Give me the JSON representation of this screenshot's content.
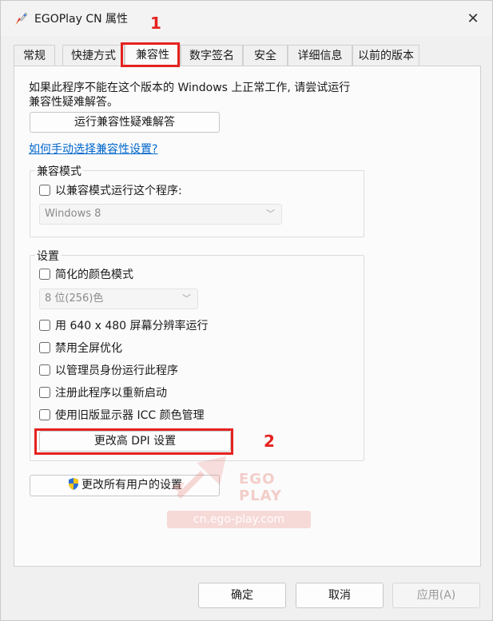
{
  "window": {
    "title": "EGOPlay CN 属性"
  },
  "tabs": [
    {
      "label": "常规"
    },
    {
      "label": "快捷方式"
    },
    {
      "label": "兼容性"
    },
    {
      "label": "数字签名"
    },
    {
      "label": "安全"
    },
    {
      "label": "详细信息"
    },
    {
      "label": "以前的版本"
    }
  ],
  "intro": {
    "line1": "如果此程序不能在这个版本的 Windows 上正常工作, 请尝试运行",
    "line2": "兼容性疑难解答。"
  },
  "troubleshoot_button": "运行兼容性疑难解答",
  "manual_link": "如何手动选择兼容性设置?",
  "compat_mode": {
    "label": "兼容模式",
    "checkbox_label": "以兼容模式运行这个程序:",
    "select_value": "Windows 8"
  },
  "settings": {
    "label": "设置",
    "reduced_color": "简化的颜色模式",
    "color_select_value": "8 位(256)色",
    "options": [
      "用 640 x 480 屏幕分辨率运行",
      "禁用全屏优化",
      "以管理员身份运行此程序",
      "注册此程序以重新启动",
      "使用旧版显示器 ICC 颜色管理"
    ],
    "dpi_button": "更改高 DPI 设置"
  },
  "all_users_button": "更改所有用户的设置",
  "annotations": {
    "step1": "1",
    "step2": "2"
  },
  "watermark": {
    "brand": "EGO PLAY",
    "url": "cn.ego-play.com"
  },
  "footer": {
    "ok": "确定",
    "cancel": "取消",
    "apply": "应用(A)"
  },
  "colors": {
    "accent_red": "#e52320",
    "link_blue": "#0066cc"
  }
}
